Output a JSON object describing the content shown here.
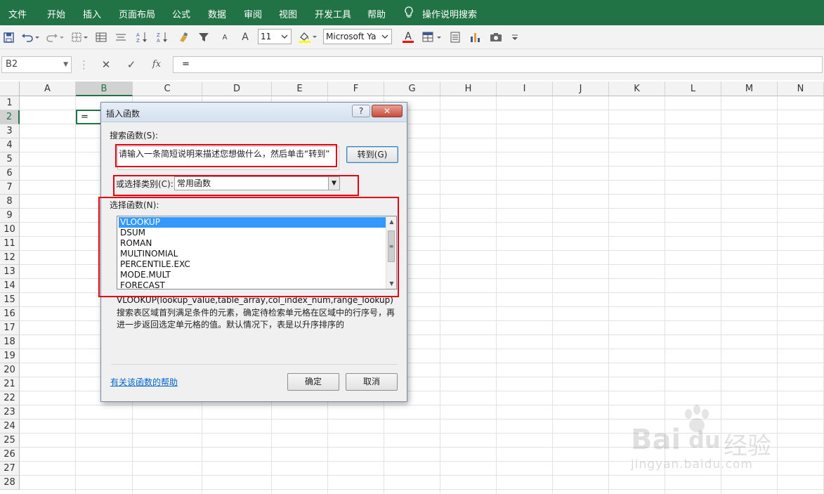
{
  "ribbon": {
    "tabs": [
      "文件",
      "开始",
      "插入",
      "页面布局",
      "公式",
      "数据",
      "审阅",
      "视图",
      "开发工具",
      "帮助"
    ],
    "tellme": "操作说明搜索",
    "accent": "#217346"
  },
  "toolbar": {
    "font_size": "11",
    "font_name": "Microsoft Ya",
    "icons": [
      "save-icon",
      "undo-icon",
      "redo-icon",
      "borders-icon",
      "freeze-panes-icon",
      "align-icon",
      "sort-ascending-icon",
      "sort-descending-icon",
      "clear-icon",
      "filter-icon",
      "decrease-font-icon",
      "increase-font-icon",
      "fill-color-icon",
      "font-color-icon",
      "format-table-icon",
      "form-icon",
      "chart-icon",
      "camera-icon",
      "customize-qat-icon"
    ],
    "fill_color": "#ffff00",
    "font_color": "#ff0000",
    "increase_font_label": "A",
    "decrease_font_label": "A",
    "font_color_label": "A"
  },
  "formula_bar": {
    "name_box": "B2",
    "cancel": "✕",
    "enter": "✓",
    "fx": "fx",
    "content": "="
  },
  "sheet": {
    "columns": [
      "A",
      "B",
      "C",
      "D",
      "E",
      "F",
      "G",
      "H",
      "I",
      "J",
      "K",
      "L",
      "M",
      "N"
    ],
    "rows": [
      "1",
      "2",
      "3",
      "4",
      "5",
      "6",
      "7",
      "8",
      "9",
      "10",
      "11",
      "12",
      "13",
      "14",
      "15",
      "16",
      "17",
      "18",
      "19",
      "20",
      "21",
      "22",
      "23",
      "24",
      "25",
      "26",
      "27",
      "28"
    ],
    "selected_column": "B",
    "selected_row": "2",
    "active_cell_value": "="
  },
  "dialog": {
    "title": "插入函数",
    "help_button": "?",
    "close_button": "✕",
    "search_label": "搜索函数(S):",
    "search_text": "请输入一条简短说明来描述您想做什么，然后单击“转到”",
    "go_button": "转到(G)",
    "category_label": "或选择类别(C):",
    "category_value": "常用函数",
    "functions_label": "选择函数(N):",
    "functions": [
      "VLOOKUP",
      "DSUM",
      "ROMAN",
      "MULTINOMIAL",
      "PERCENTILE.EXC",
      "MODE.MULT",
      "FORECAST"
    ],
    "selected_function": "VLOOKUP",
    "signature": "VLOOKUP(lookup_value,table_array,col_index_num,range_lookup)",
    "description": "搜索表区域首列满足条件的元素，确定待检索单元格在区域中的行序号，再进一步返回选定单元格的值。默认情况下，表是以升序排序的",
    "help_link": "有关该函数的帮助",
    "ok_button": "确定",
    "cancel_button": "取消"
  },
  "watermark": {
    "brand": "Bai",
    "brand_tail": "du",
    "suffix": "经验",
    "url": "jingyan.baidu.com"
  }
}
